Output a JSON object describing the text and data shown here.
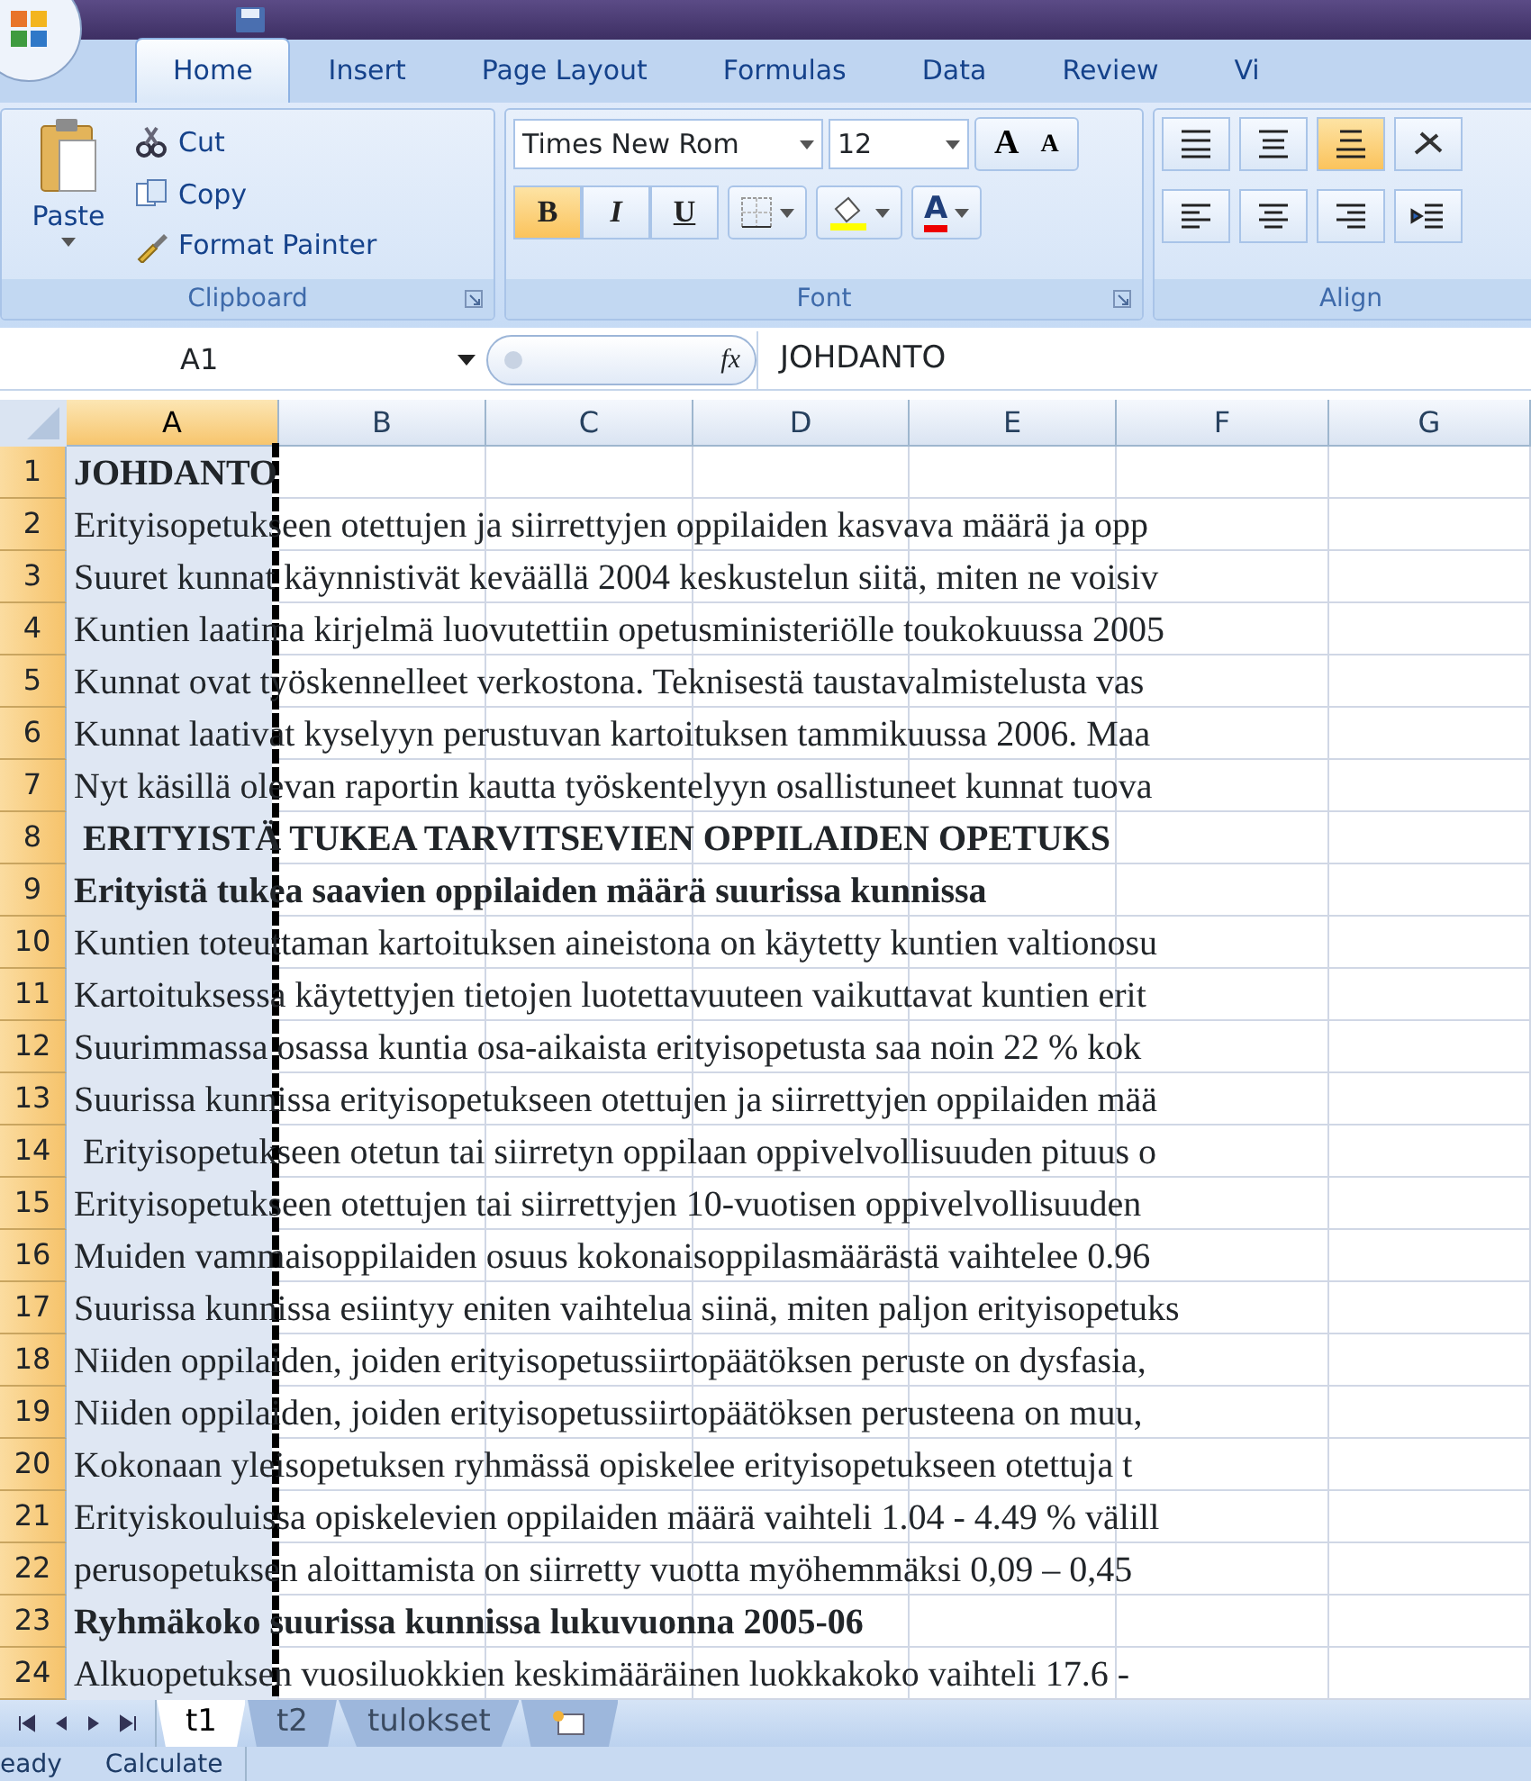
{
  "ribbon_tabs": [
    {
      "label": "Home",
      "selected": true
    },
    {
      "label": "Insert",
      "selected": false
    },
    {
      "label": "Page Layout",
      "selected": false
    },
    {
      "label": "Formulas",
      "selected": false
    },
    {
      "label": "Data",
      "selected": false
    },
    {
      "label": "Review",
      "selected": false
    },
    {
      "label": "Vi",
      "selected": false
    }
  ],
  "clipboard": {
    "label": "Clipboard",
    "paste": "Paste",
    "items": [
      {
        "kind": "cut",
        "label": "Cut"
      },
      {
        "kind": "copy",
        "label": "Copy"
      },
      {
        "kind": "painter",
        "label": "Format Painter"
      }
    ]
  },
  "font": {
    "label": "Font",
    "font_name": "Times New Rom",
    "font_size": "12",
    "grow": "A",
    "shrink": "A",
    "color_letter": "A",
    "styles": [
      {
        "kind": "bold",
        "label": "B",
        "on": true
      },
      {
        "kind": "italic",
        "label": "I",
        "on": false
      },
      {
        "kind": "underline",
        "label": "U",
        "on": false
      }
    ]
  },
  "alignment": {
    "label": "Align",
    "buttons": [
      {
        "kind": "top",
        "on": false
      },
      {
        "kind": "middle",
        "on": false
      },
      {
        "kind": "bottom",
        "on": true
      },
      {
        "kind": "orientation",
        "on": false
      },
      {
        "kind": "left",
        "on": false
      },
      {
        "kind": "center",
        "on": false
      },
      {
        "kind": "right",
        "on": false
      },
      {
        "kind": "indent",
        "on": false
      }
    ]
  },
  "formula_bar": {
    "name_box": "A1",
    "fx": "fx",
    "formula": "JOHDANTO"
  },
  "columns": [
    {
      "label": "A",
      "selected": true
    },
    {
      "label": "B",
      "selected": false
    },
    {
      "label": "C",
      "selected": false
    },
    {
      "label": "D",
      "selected": false
    },
    {
      "label": "E",
      "selected": false
    },
    {
      "label": "F",
      "selected": false
    },
    {
      "label": "G",
      "selected": false
    }
  ],
  "rows": [
    {
      "number": "1",
      "text": "JOHDANTO",
      "bold": true
    },
    {
      "number": "2",
      "text": "Erityisopetukseen otettujen ja siirrettyjen oppilaiden kasvava määrä ja opp",
      "bold": false
    },
    {
      "number": "3",
      "text": "Suuret kunnat käynnistivät keväällä 2004 keskustelun siitä, miten ne voisiv",
      "bold": false
    },
    {
      "number": "4",
      "text": "Kuntien laatima kirjelmä luovutettiin opetusministeriölle toukokuussa 2005",
      "bold": false
    },
    {
      "number": "5",
      "text": "Kunnat ovat työskennelleet verkostona. Teknisestä taustavalmistelusta vas",
      "bold": false
    },
    {
      "number": "6",
      "text": "Kunnat laativat kyselyyn perustuvan kartoituksen tammikuussa 2006. Maa",
      "bold": false
    },
    {
      "number": "7",
      "text": "Nyt käsillä olevan raportin kautta työskentelyyn osallistuneet kunnat tuova",
      "bold": false
    },
    {
      "number": "8",
      "text": " ERITYISTÄ TUKEA TARVITSEVIEN OPPILAIDEN OPETUKS",
      "bold": true
    },
    {
      "number": "9",
      "text": "Erityistä tukea saavien oppilaiden määrä suurissa kunnissa",
      "bold": true
    },
    {
      "number": "10",
      "text": "Kuntien toteuttaman kartoituksen aineistona on käytetty kuntien valtionosu",
      "bold": false
    },
    {
      "number": "11",
      "text": "Kartoituksessa käytettyjen tietojen luotettavuuteen vaikuttavat kuntien erit",
      "bold": false
    },
    {
      "number": "12",
      "text": "Suurimmassa osassa kuntia osa-aikaista erityisopetusta saa noin 22 % kok",
      "bold": false
    },
    {
      "number": "13",
      "text": "Suurissa kunnissa erityisopetukseen otettujen ja siirrettyjen oppilaiden mää",
      "bold": false
    },
    {
      "number": "14",
      "text": " Erityisopetukseen otetun tai siirretyn oppilaan oppivelvollisuuden pituus o",
      "bold": false
    },
    {
      "number": "15",
      "text": "Erityisopetukseen otettujen tai siirrettyjen 10-vuotisen oppivelvollisuuden",
      "bold": false
    },
    {
      "number": "16",
      "text": "Muiden vammaisoppilaiden osuus kokonaisoppilasmäärästä vaihtelee 0.96",
      "bold": false
    },
    {
      "number": "17",
      "text": "Suurissa kunnissa esiintyy eniten vaihtelua siinä, miten paljon erityisopetuks",
      "bold": false
    },
    {
      "number": "18",
      "text": "Niiden oppilaiden, joiden erityisopetussiirtopäätöksen peruste on dysfasia,",
      "bold": false
    },
    {
      "number": "19",
      "text": "Niiden oppilaiden, joiden erityisopetussiirtopäätöksen perusteena on muu,",
      "bold": false
    },
    {
      "number": "20",
      "text": "Kokonaan yleisopetuksen ryhmässä opiskelee erityisopetukseen otettuja t",
      "bold": false
    },
    {
      "number": "21",
      "text": "Erityiskouluissa opiskelevien oppilaiden määrä vaihteli 1.04 - 4.49 % välill",
      "bold": false
    },
    {
      "number": "22",
      "text": "perusopetuksen aloittamista on siirretty vuotta myöhemmäksi 0,09 – 0,45",
      "bold": false
    },
    {
      "number": "23",
      "text": "Ryhmäkoko suurissa kunnissa lukuvuonna 2005-06",
      "bold": true
    },
    {
      "number": "24",
      "text": "Alkuopetuksen vuosiluokkien keskimääräinen luokkakoko vaihteli 17.6 -",
      "bold": false
    }
  ],
  "sheet_tabs": [
    {
      "label": "t1",
      "selected": true
    },
    {
      "label": "t2",
      "selected": false
    },
    {
      "label": "tulokset",
      "selected": false
    }
  ],
  "status_bar": {
    "mode": "eady",
    "calc": "Calculate"
  }
}
